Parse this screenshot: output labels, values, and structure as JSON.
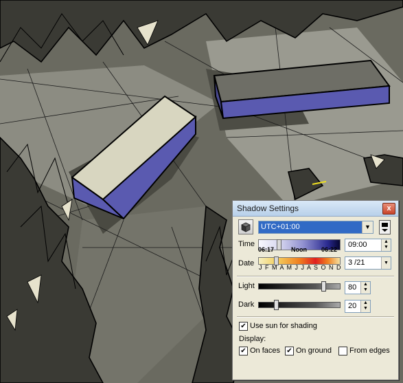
{
  "dialog": {
    "title": "Shadow Settings",
    "close_glyph": "x",
    "timezone": "UTC+01:00",
    "time": {
      "label": "Time",
      "sunrise": "06:17",
      "noon": "Noon",
      "sunset": "06:22",
      "value": "09:00"
    },
    "date": {
      "label": "Date",
      "months": "J F M A M J J A S O N D",
      "value": "3 /21"
    },
    "light": {
      "label": "Light",
      "value": "80",
      "level": 0.8
    },
    "dark": {
      "label": "Dark",
      "value": "20",
      "level": 0.2
    },
    "use_sun": {
      "label": "Use sun for shading",
      "checked": true
    },
    "display_label": "Display:",
    "on_faces": {
      "label": "On faces",
      "checked": true
    },
    "on_ground": {
      "label": "On ground",
      "checked": true
    },
    "from_edges": {
      "label": "From edges",
      "checked": false
    }
  },
  "colors": {
    "scene_ground": "#5e5e55",
    "building_wall": "#5a5ab0",
    "building_roof": "#d8d6c0",
    "accent_selection": "#316ac5"
  },
  "icons": [
    "shadow-toggle-icon",
    "display-pane-icon",
    "close-icon",
    "chevron-down-icon"
  ]
}
